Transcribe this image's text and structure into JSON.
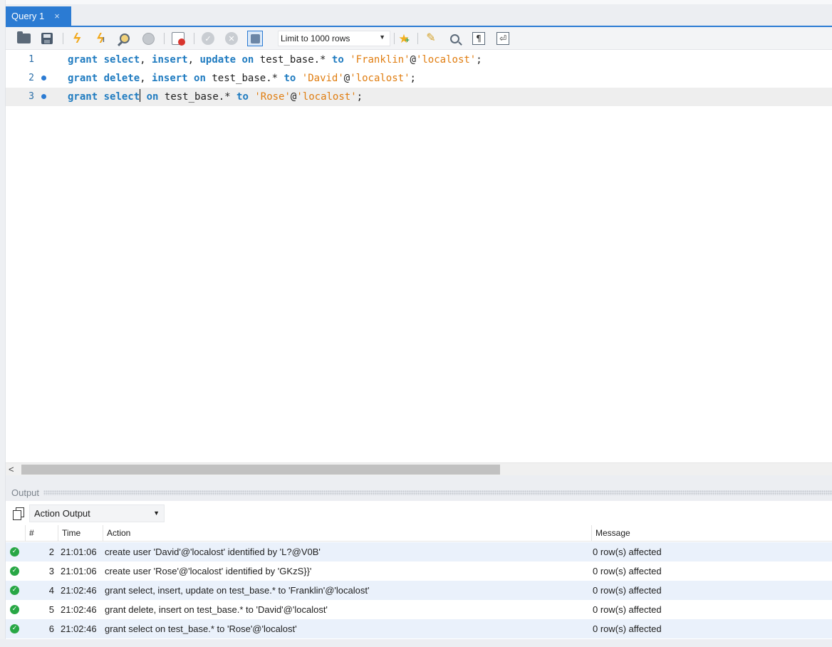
{
  "tab": {
    "title": "Query 1",
    "close": "×"
  },
  "toolbar": {
    "limit_label": "Limit to 1000 rows",
    "icons": [
      "open-folder-icon",
      "save-icon",
      "execute-icon",
      "execute-current-icon",
      "explain-icon",
      "stop-icon",
      "error-toggle-icon",
      "commit-icon",
      "rollback-icon",
      "autocommit-icon",
      "add-snippet-icon",
      "beautify-icon",
      "find-icon",
      "invisible-chars-icon",
      "word-wrap-icon"
    ],
    "invisible_glyph": "¶",
    "wrap_glyph": "⏎"
  },
  "editor": {
    "lines": [
      {
        "number": "1",
        "marker": false
      },
      {
        "number": "2",
        "marker": true
      },
      {
        "number": "3",
        "marker": true
      }
    ],
    "current_line": 3,
    "code": [
      [
        "grant",
        " ",
        "select",
        ", ",
        "insert",
        ", ",
        "update",
        " ",
        "on",
        " test_base.* ",
        "to",
        " ",
        "'Franklin'",
        "@",
        "'localost'",
        ";"
      ],
      [
        "grant",
        " ",
        "delete",
        ", ",
        "insert",
        " ",
        "on",
        " test_base.* ",
        "to",
        " ",
        "'David'",
        "@",
        "'localost'",
        ";"
      ],
      [
        "grant",
        " ",
        "select",
        "",
        " ",
        "on",
        " test_base.* ",
        "to",
        " ",
        "'Rose'",
        "@",
        "'localost'",
        ";"
      ]
    ]
  },
  "output": {
    "title": "Output",
    "selector": "Action Output",
    "columns": {
      "num": "#",
      "time": "Time",
      "action": "Action",
      "message": "Message"
    },
    "rows": [
      {
        "num": "2",
        "time": "21:01:06",
        "action": "create user 'David'@'localost' identified by 'L?@V0B'",
        "message": "0 row(s) affected"
      },
      {
        "num": "3",
        "time": "21:01:06",
        "action": "create user 'Rose'@'localost' identified by 'GKzS}}'",
        "message": "0 row(s) affected"
      },
      {
        "num": "4",
        "time": "21:02:46",
        "action": "grant select, insert, update on test_base.* to 'Franklin'@'localost'",
        "message": "0 row(s) affected"
      },
      {
        "num": "5",
        "time": "21:02:46",
        "action": "grant delete, insert on test_base.* to 'David'@'localost'",
        "message": "0 row(s) affected"
      },
      {
        "num": "6",
        "time": "21:02:46",
        "action": "grant select on test_base.* to 'Rose'@'localost'",
        "message": "0 row(s) affected"
      }
    ]
  },
  "colors": {
    "accent": "#2b7bd3",
    "keyword": "#1f7bc0",
    "string": "#e07d10",
    "success": "#28a745"
  }
}
